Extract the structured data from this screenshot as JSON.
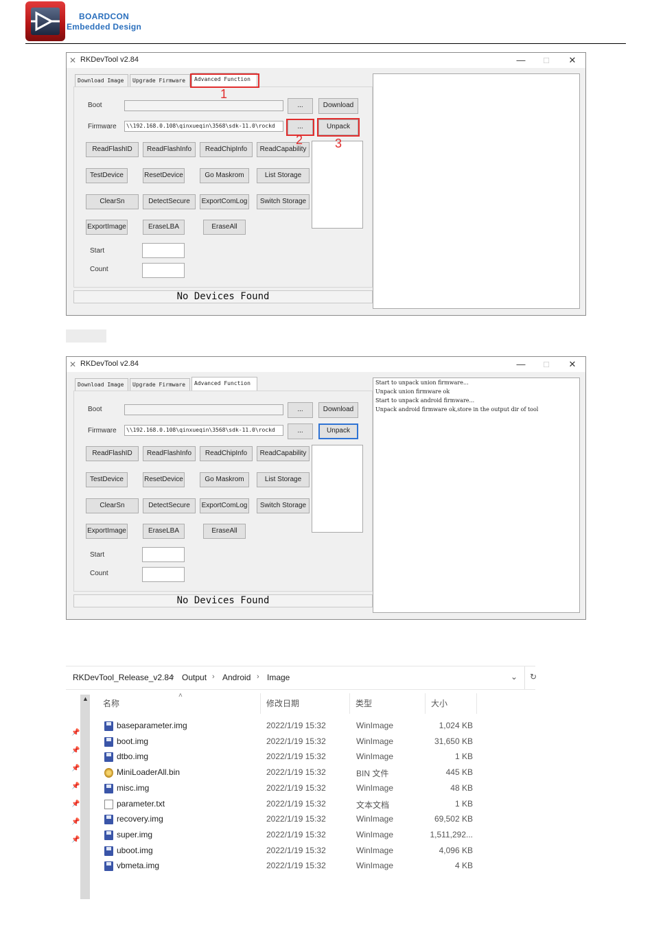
{
  "header": {
    "brand_line1": "BOARDCON",
    "brand_line2": "Embedded Design"
  },
  "window1": {
    "title": "RKDevTool v2.84",
    "controls": {
      "minimize": "—",
      "maximize": "□",
      "close": "✕"
    },
    "tabs": [
      "Download Image",
      "Upgrade Firmware",
      "Advanced Function"
    ],
    "boot_label": "Boot",
    "firmware_label": "Firmware",
    "firmware_path": "\\\\192.168.0.108\\qinxueqin\\3568\\sdk-11.0\\rockd",
    "browse_label": "...",
    "download_label": "Download",
    "unpack_label": "Unpack",
    "buttons": [
      [
        "ReadFlashID",
        "ReadFlashInfo",
        "ReadChipInfo",
        "ReadCapability"
      ],
      [
        "TestDevice",
        "ResetDevice",
        "Go Maskrom",
        "List Storage"
      ],
      [
        "ClearSn",
        "DetectSecure",
        "ExportComLog",
        "Switch Storage"
      ],
      [
        "ExportImage",
        "EraseLBA",
        "EraseAll"
      ]
    ],
    "start_label": "Start",
    "count_label": "Count",
    "status": "No Devices Found",
    "annotations": [
      "1",
      "2",
      "3"
    ]
  },
  "window2": {
    "title": "RKDevTool v2.84",
    "controls": {
      "minimize": "—",
      "maximize": "□",
      "close": "✕"
    },
    "tabs": [
      "Download Image",
      "Upgrade Firmware",
      "Advanced Function"
    ],
    "boot_label": "Boot",
    "firmware_label": "Firmware",
    "firmware_path": "\\\\192.168.0.108\\qinxueqin\\3568\\sdk-11.0\\rockd",
    "browse_label": "...",
    "download_label": "Download",
    "unpack_label": "Unpack",
    "buttons": [
      [
        "ReadFlashID",
        "ReadFlashInfo",
        "ReadChipInfo",
        "ReadCapability"
      ],
      [
        "TestDevice",
        "ResetDevice",
        "Go Maskrom",
        "List Storage"
      ],
      [
        "ClearSn",
        "DetectSecure",
        "ExportComLog",
        "Switch Storage"
      ],
      [
        "ExportImage",
        "EraseLBA",
        "EraseAll"
      ]
    ],
    "start_label": "Start",
    "count_label": "Count",
    "status": "No Devices Found",
    "log": [
      "Start to unpack union firmware...",
      "Unpack union firmware ok",
      "Start to unpack android firmware...",
      "Unpack android firmware ok,store in the output dir of tool"
    ]
  },
  "explorer": {
    "breadcrumb": [
      "RKDevTool_Release_v2.84",
      "Output",
      "Android",
      "Image"
    ],
    "columns": {
      "name": "名称",
      "date": "修改日期",
      "type": "类型",
      "size": "大小"
    },
    "files": [
      {
        "name": "baseparameter.img",
        "date": "2022/1/19 15:32",
        "type": "WinImage",
        "size": "1,024 KB",
        "icon": "disk-image-icon"
      },
      {
        "name": "boot.img",
        "date": "2022/1/19 15:32",
        "type": "WinImage",
        "size": "31,650 KB",
        "icon": "disk-image-icon"
      },
      {
        "name": "dtbo.img",
        "date": "2022/1/19 15:32",
        "type": "WinImage",
        "size": "1 KB",
        "icon": "disk-image-icon"
      },
      {
        "name": "MiniLoaderAll.bin",
        "date": "2022/1/19 15:32",
        "type": "BIN 文件",
        "size": "445 KB",
        "icon": "bin-file-icon"
      },
      {
        "name": "misc.img",
        "date": "2022/1/19 15:32",
        "type": "WinImage",
        "size": "48 KB",
        "icon": "disk-image-icon"
      },
      {
        "name": "parameter.txt",
        "date": "2022/1/19 15:32",
        "type": "文本文档",
        "size": "1 KB",
        "icon": "text-file-icon"
      },
      {
        "name": "recovery.img",
        "date": "2022/1/19 15:32",
        "type": "WinImage",
        "size": "69,502 KB",
        "icon": "disk-image-icon"
      },
      {
        "name": "super.img",
        "date": "2022/1/19 15:32",
        "type": "WinImage",
        "size": "1,511,292...",
        "icon": "disk-image-icon"
      },
      {
        "name": "uboot.img",
        "date": "2022/1/19 15:32",
        "type": "WinImage",
        "size": "4,096 KB",
        "icon": "disk-image-icon"
      },
      {
        "name": "vbmeta.img",
        "date": "2022/1/19 15:32",
        "type": "WinImage",
        "size": "4 KB",
        "icon": "disk-image-icon"
      }
    ]
  }
}
